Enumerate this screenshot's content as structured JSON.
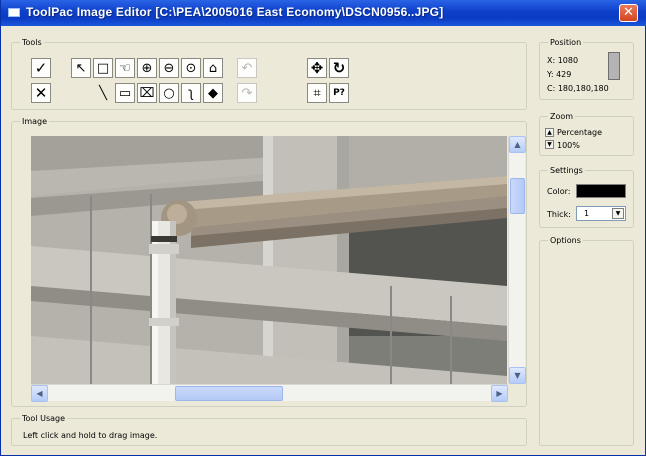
{
  "window": {
    "title": "ToolPac Image Editor [C:\\PEA\\2005016 East Economy\\DSCN0956..JPG]",
    "close_glyph": "✕"
  },
  "tools": {
    "legend": "Tools",
    "buttons": [
      {
        "name": "accept-check-button",
        "glyph": "✓",
        "enabled": true,
        "icon": "check-icon"
      },
      {
        "name": "cancel-x-button",
        "glyph": "✕",
        "enabled": true,
        "icon": "x-icon"
      },
      {
        "name": "pointer-tool-button",
        "glyph": "↖",
        "enabled": true,
        "icon": "arrow-pointer-icon"
      },
      {
        "name": "rectangle-select-button",
        "glyph": "□",
        "enabled": true,
        "icon": "rectangle-icon"
      },
      {
        "name": "pan-hand-button",
        "glyph": "☜",
        "enabled": true,
        "icon": "hand-icon"
      },
      {
        "name": "zoom-in-button",
        "glyph": "⊕",
        "enabled": true,
        "icon": "magnifier-plus-icon"
      },
      {
        "name": "zoom-out-button",
        "glyph": "⊖",
        "enabled": true,
        "icon": "magnifier-minus-icon"
      },
      {
        "name": "zoom-fit-button",
        "glyph": "⊙",
        "enabled": true,
        "icon": "magnifier-icon"
      },
      {
        "name": "callout-button",
        "glyph": "⌂",
        "enabled": true,
        "icon": "callout-icon"
      },
      {
        "name": "undo-button",
        "glyph": "↶",
        "enabled": false,
        "icon": "undo-icon"
      },
      {
        "name": "redo-button",
        "glyph": "↷",
        "enabled": false,
        "icon": "redo-icon"
      },
      {
        "name": "line-tool-button",
        "glyph": "╲",
        "enabled": true,
        "icon": "line-icon"
      },
      {
        "name": "rectangle-tool-button",
        "glyph": "▭",
        "enabled": true,
        "icon": "rectangle-icon"
      },
      {
        "name": "polygon-tool-button",
        "glyph": "⌧",
        "enabled": true,
        "icon": "polygon-icon"
      },
      {
        "name": "ellipse-tool-button",
        "glyph": "○",
        "enabled": true,
        "icon": "ellipse-icon"
      },
      {
        "name": "freehand-tool-button",
        "glyph": "ʅ",
        "enabled": true,
        "icon": "freehand-icon"
      },
      {
        "name": "fill-tool-button",
        "glyph": "◆",
        "enabled": true,
        "icon": "paint-bucket-icon"
      },
      {
        "name": "move-tool-button",
        "glyph": "✥",
        "enabled": true,
        "icon": "move-icon"
      },
      {
        "name": "rotate-tool-button",
        "glyph": "↻",
        "enabled": true,
        "icon": "rotate-icon"
      },
      {
        "name": "crop-tool-button",
        "glyph": "⌗",
        "enabled": true,
        "icon": "crop-icon"
      },
      {
        "name": "p-query-button",
        "glyph": "P?",
        "enabled": true,
        "icon": "p-question-icon"
      }
    ]
  },
  "image_panel": {
    "legend": "Image",
    "scroll_up": "▲",
    "scroll_down": "▼",
    "scroll_left": "◀",
    "scroll_right": "▶"
  },
  "position": {
    "legend": "Position",
    "x": "X: 1080",
    "y": "Y: 429",
    "c": "C: 180,180,180",
    "swatch_color": "#b4b4b4"
  },
  "zoom": {
    "legend": "Zoom",
    "mode": "Percentage",
    "value": "100%",
    "up": "▲",
    "down": "▼"
  },
  "settings": {
    "legend": "Settings",
    "color_label": "Color:",
    "color_value": "#000000",
    "thick_label": "Thick:",
    "thick_value": "1",
    "thick_arrow": "▼"
  },
  "options": {
    "legend": "Options"
  },
  "tool_usage": {
    "legend": "Tool Usage",
    "text": "Left click and hold to drag image."
  }
}
